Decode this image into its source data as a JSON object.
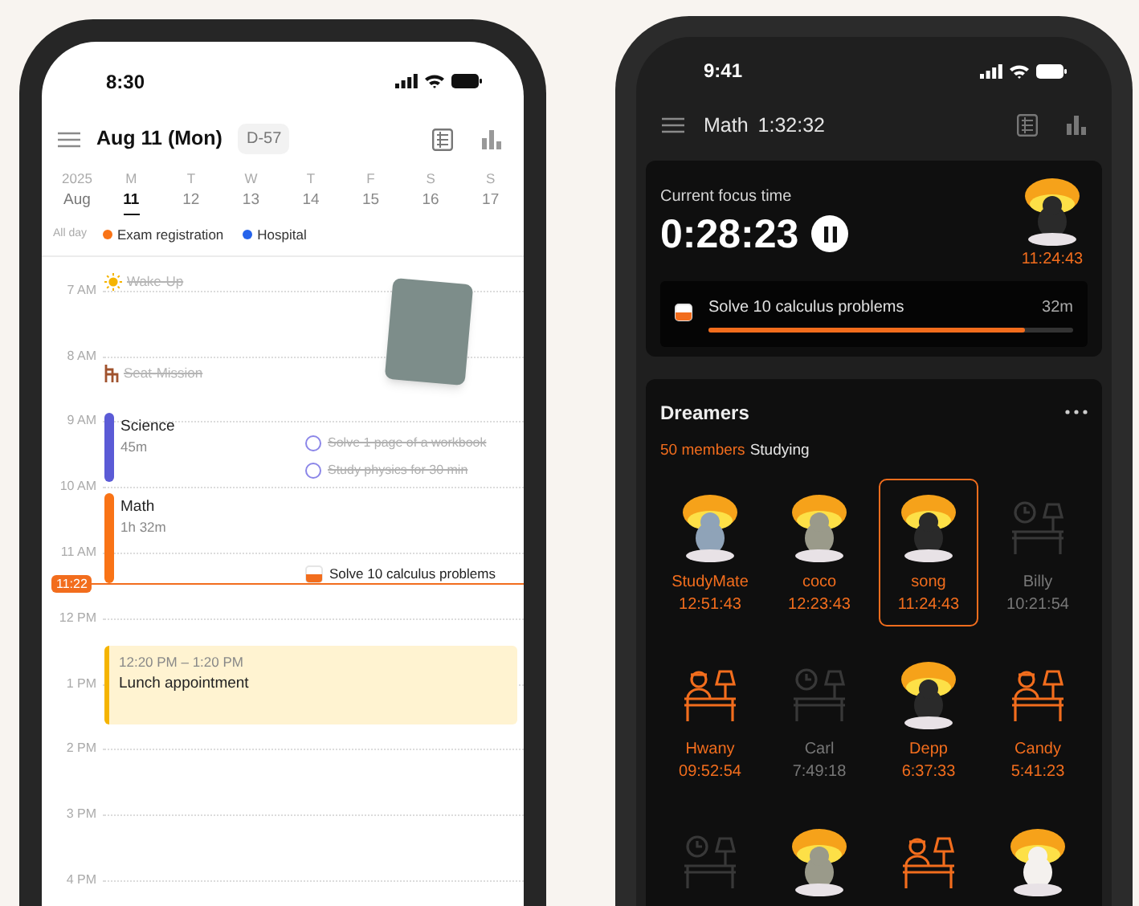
{
  "calendar_phone": {
    "status_time": "8:30",
    "header": {
      "title": "Aug 11 (Mon)",
      "badge": "D-57"
    },
    "week": {
      "year": "2025",
      "month": "Aug",
      "days": [
        {
          "letter": "M",
          "date": "11",
          "selected": true
        },
        {
          "letter": "T",
          "date": "12",
          "selected": false
        },
        {
          "letter": "W",
          "date": "13",
          "selected": false
        },
        {
          "letter": "T",
          "date": "14",
          "selected": false
        },
        {
          "letter": "F",
          "date": "15",
          "selected": false
        },
        {
          "letter": "S",
          "date": "16",
          "selected": false
        },
        {
          "letter": "S",
          "date": "17",
          "selected": false
        }
      ]
    },
    "all_day": {
      "label": "All day",
      "events": [
        {
          "title": "Exam registration",
          "color": "#f97316"
        },
        {
          "title": "Hospital",
          "color": "#2563eb"
        }
      ]
    },
    "hours": [
      "7 AM",
      "8 AM",
      "9 AM",
      "10 AM",
      "11 AM",
      "12 PM",
      "1 PM",
      "2 PM",
      "3 PM",
      "4 PM"
    ],
    "routines": [
      {
        "kind": "sun",
        "title": "Wake-Up",
        "done": true
      },
      {
        "kind": "chair",
        "title": "Seat-Mission",
        "done": true
      }
    ],
    "sessions": [
      {
        "subject": "Science",
        "duration": "45m",
        "color": "#5b5bd6"
      },
      {
        "subject": "Math",
        "duration": "1h 32m",
        "color": "#f97316"
      }
    ],
    "todos": [
      {
        "title": "Solve 1 page of a workbook",
        "done": true
      },
      {
        "title": "Study physics for 30 min",
        "done": true
      },
      {
        "title": "Solve 10 calculus problems",
        "done": false
      }
    ],
    "now": "11:22",
    "appointment": {
      "time": "12:20 PM – 1:20 PM",
      "title": "Lunch appointment"
    }
  },
  "focus_phone": {
    "status_time": "9:41",
    "header": {
      "subject": "Math",
      "total": "1:32:32"
    },
    "focus": {
      "label": "Current focus time",
      "timer": "0:28:23",
      "paused": false,
      "avatar_time": "11:24:43",
      "task": {
        "title": "Solve 10 calculus problems",
        "duration": "32m",
        "level": 0.87
      }
    },
    "dreamers": {
      "title": "Dreamers",
      "count": "50 members",
      "status": "Studying",
      "members": [
        {
          "name": "StudyMate",
          "time": "12:51:43",
          "kind": "illustration",
          "studying": true,
          "selected": false
        },
        {
          "name": "coco",
          "time": "12:23:43",
          "kind": "illustration",
          "studying": true,
          "selected": false
        },
        {
          "name": "song",
          "time": "11:24:43",
          "kind": "illustration",
          "studying": true,
          "selected": true
        },
        {
          "name": "Billy",
          "time": "10:21:54",
          "kind": "clock",
          "studying": false,
          "selected": false
        },
        {
          "name": "Hwany",
          "time": "09:52:54",
          "kind": "person",
          "studying": true,
          "selected": false
        },
        {
          "name": "Carl",
          "time": "7:49:18",
          "kind": "clock",
          "studying": false,
          "selected": false
        },
        {
          "name": "Depp",
          "time": "6:37:33",
          "kind": "illustration",
          "studying": true,
          "selected": false
        },
        {
          "name": "Candy",
          "time": "5:41:23",
          "kind": "person",
          "studying": true,
          "selected": false
        },
        {
          "kind": "clock",
          "studying": false,
          "selected": false
        },
        {
          "kind": "illustration",
          "studying": true,
          "selected": false
        },
        {
          "kind": "person",
          "studying": true,
          "selected": false
        },
        {
          "kind": "illustration",
          "studying": true,
          "selected": false
        }
      ]
    }
  }
}
